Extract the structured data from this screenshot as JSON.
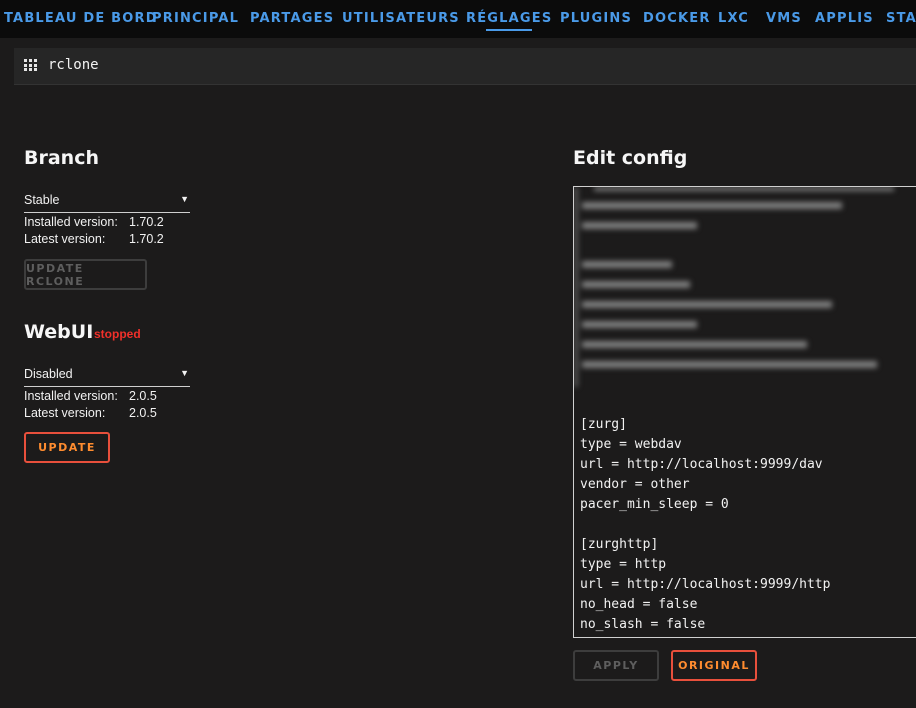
{
  "nav": {
    "items": [
      "TABLEAU DE BORD",
      "PRINCIPAL",
      "PARTAGES",
      "UTILISATEURS",
      "RÉGLAGES",
      "PLUGINS",
      "DOCKER",
      "LXC",
      "VMS",
      "APPLIS",
      "STATS"
    ],
    "active_index": 4,
    "color": "#4a9ae8"
  },
  "header": {
    "title": "rclone",
    "icon": "grid-icon"
  },
  "branch": {
    "heading": "Branch",
    "selected": "Stable",
    "installed_label": "Installed version:",
    "installed_value": "1.70.2",
    "latest_label": "Latest version:",
    "latest_value": "1.70.2",
    "update_button": "UPDATE RCLONE"
  },
  "webui": {
    "heading": "WebUI",
    "status": "stopped",
    "status_color": "#f0302a",
    "selected": "Disabled",
    "installed_label": "Installed version:",
    "installed_value": "2.0.5",
    "latest_label": "Latest version:",
    "latest_value": "2.0.5",
    "update_button": "UPDATE"
  },
  "config": {
    "heading": "Edit config",
    "text": "[zurg]\ntype = webdav\nurl = http://localhost:9999/dav\nvendor = other\npacer_min_sleep = 0\n\n[zurghttp]\ntype = http\nurl = http://localhost:9999/http\nno_head = false\nno_slash = false",
    "apply_button": "APPLY",
    "original_button": "ORIGINAL"
  },
  "accent": "#e8503c"
}
